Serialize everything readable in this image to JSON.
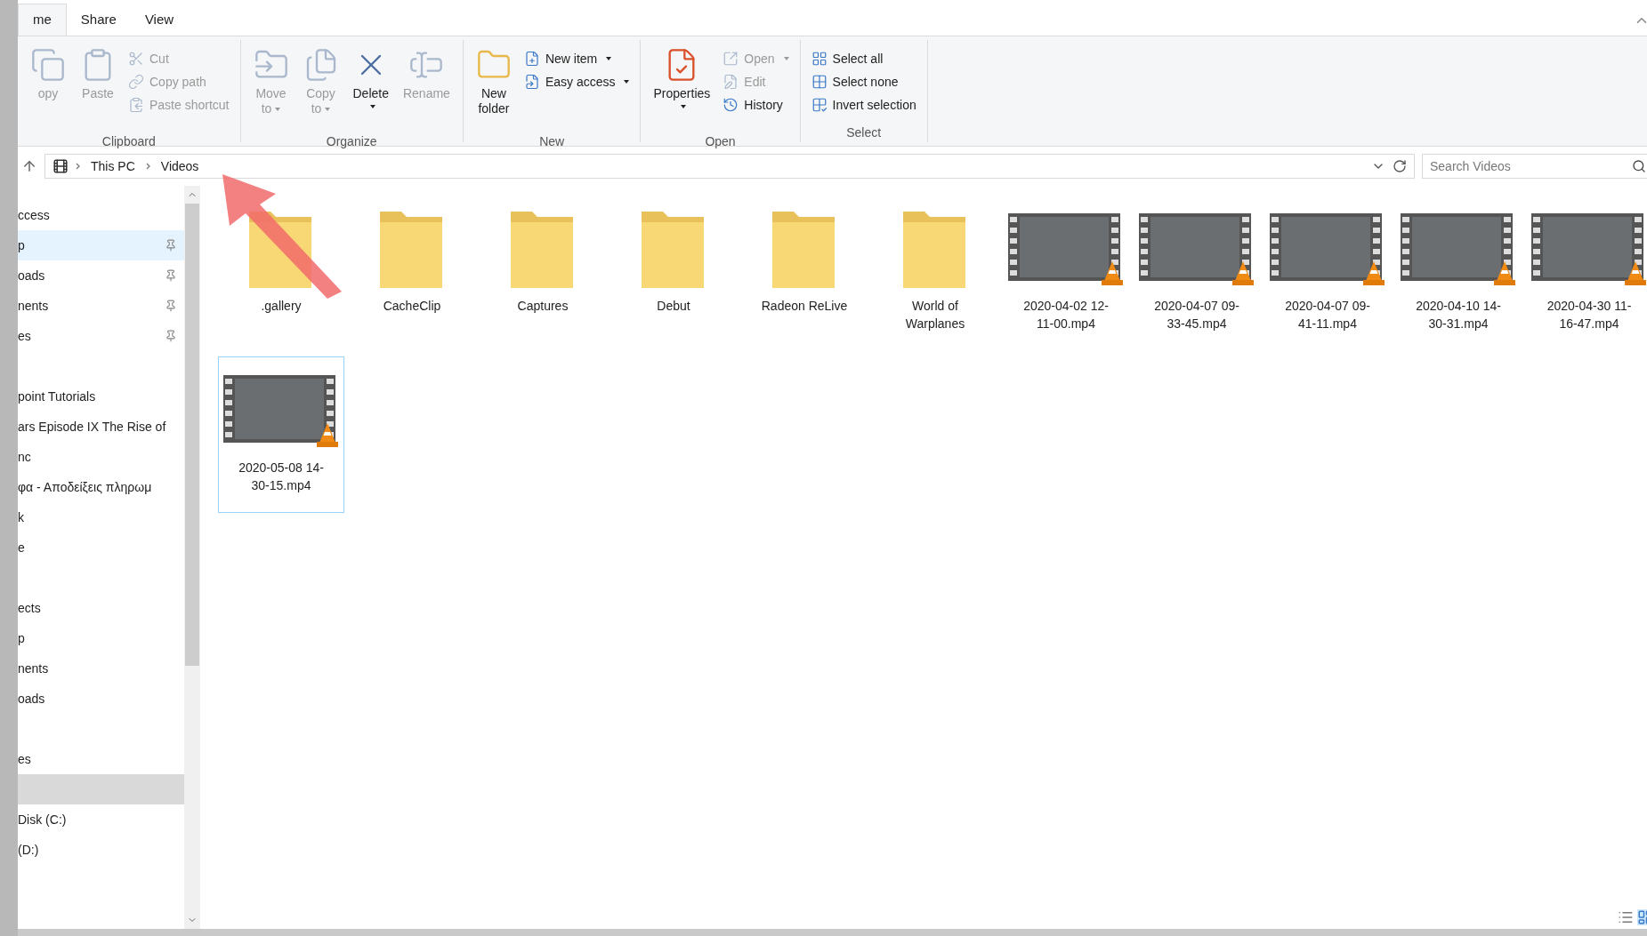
{
  "tabs": [
    {
      "label": "me",
      "selected": true
    },
    {
      "label": "Share",
      "selected": false
    },
    {
      "label": "View",
      "selected": false
    }
  ],
  "ribbon": {
    "groups": [
      {
        "label": "Clipboard",
        "commands": [
          {
            "kind": "large",
            "lines": [
              "opy"
            ],
            "disabled": true,
            "dropdown": false
          },
          {
            "kind": "large",
            "lines": [
              "Paste"
            ],
            "disabled": true,
            "dropdown": false
          },
          {
            "kind": "small",
            "lines": [
              "Cut"
            ],
            "disabled": true,
            "dropdown": false
          },
          {
            "kind": "small",
            "lines": [
              "Copy path"
            ],
            "disabled": true,
            "dropdown": false
          },
          {
            "kind": "small",
            "lines": [
              "Paste shortcut"
            ],
            "disabled": true,
            "dropdown": false
          }
        ]
      },
      {
        "label": "Organize",
        "commands": [
          {
            "kind": "large",
            "lines": [
              "Move",
              "to"
            ],
            "disabled": true,
            "dropdown": true
          },
          {
            "kind": "large",
            "lines": [
              "Copy",
              "to"
            ],
            "disabled": true,
            "dropdown": true
          },
          {
            "kind": "large",
            "lines": [
              "Delete"
            ],
            "disabled": false,
            "dropdown": true
          },
          {
            "kind": "large",
            "lines": [
              "Rename"
            ],
            "disabled": true,
            "dropdown": false
          }
        ]
      },
      {
        "label": "New",
        "commands": [
          {
            "kind": "large",
            "lines": [
              "New",
              "folder"
            ],
            "disabled": false,
            "dropdown": false
          },
          {
            "kind": "small",
            "lines": [
              "New item"
            ],
            "disabled": false,
            "dropdown": true
          },
          {
            "kind": "small",
            "lines": [
              "Easy access"
            ],
            "disabled": false,
            "dropdown": true
          }
        ]
      },
      {
        "label": "Open",
        "commands": [
          {
            "kind": "large",
            "lines": [
              "Properties"
            ],
            "disabled": false,
            "dropdown": true
          },
          {
            "kind": "small",
            "lines": [
              "Open"
            ],
            "disabled": true,
            "dropdown": true
          },
          {
            "kind": "small",
            "lines": [
              "Edit"
            ],
            "disabled": true,
            "dropdown": false
          },
          {
            "kind": "small",
            "lines": [
              "History"
            ],
            "disabled": false,
            "dropdown": false
          }
        ]
      },
      {
        "label": "Select",
        "commands": [
          {
            "kind": "small",
            "lines": [
              "Select all"
            ],
            "disabled": false,
            "dropdown": false
          },
          {
            "kind": "small",
            "lines": [
              "Select none"
            ],
            "disabled": false,
            "dropdown": false
          },
          {
            "kind": "small",
            "lines": [
              "Invert selection"
            ],
            "disabled": false,
            "dropdown": false
          }
        ]
      }
    ]
  },
  "address": {
    "breadcrumbs": [
      "This PC",
      "Videos"
    ],
    "search": {
      "placeholder": "Search Videos"
    }
  },
  "sidebar": {
    "sections": [
      {
        "items": [
          {
            "label": "ccess",
            "pinned": false,
            "hovered": false,
            "selected": false
          },
          {
            "label": "p",
            "pinned": true,
            "hovered": true,
            "selected": false
          },
          {
            "label": "oads",
            "pinned": true,
            "hovered": false,
            "selected": false
          },
          {
            "label": "nents",
            "pinned": true,
            "hovered": false,
            "selected": false
          },
          {
            "label": "es",
            "pinned": true,
            "hovered": false,
            "selected": false
          }
        ]
      },
      {
        "items": [
          {
            "label": "point Tutorials",
            "pinned": false,
            "hovered": false,
            "selected": false
          },
          {
            "label": "ars Episode IX The Rise of",
            "pinned": false,
            "hovered": false,
            "selected": false
          },
          {
            "label": "nc",
            "pinned": false,
            "hovered": false,
            "selected": false
          },
          {
            "label": "φα - Αποδείξεις πληρωμ",
            "pinned": false,
            "hovered": false,
            "selected": false
          },
          {
            "label": "k",
            "pinned": false,
            "hovered": false,
            "selected": false
          },
          {
            "label": "e",
            "pinned": false,
            "hovered": false,
            "selected": false
          }
        ]
      },
      {
        "items": [
          {
            "label": "ects",
            "pinned": false,
            "hovered": false,
            "selected": false
          },
          {
            "label": "p",
            "pinned": false,
            "hovered": false,
            "selected": false
          },
          {
            "label": "nents",
            "pinned": false,
            "hovered": false,
            "selected": false
          },
          {
            "label": "oads",
            "pinned": false,
            "hovered": false,
            "selected": false
          }
        ]
      },
      {
        "items": [
          {
            "label": "es",
            "pinned": false,
            "hovered": false,
            "selected": false
          },
          {
            "pinned": false,
            "hovered": false,
            "selected": true
          },
          {
            "label": "Disk (C:)",
            "pinned": false,
            "hovered": false,
            "selected": false
          },
          {
            "label": "(D:)",
            "pinned": false,
            "hovered": false,
            "selected": false
          }
        ]
      }
    ]
  },
  "files": [
    {
      "kind": "folder",
      "name": ".gallery",
      "selected": false
    },
    {
      "kind": "folder",
      "name": "CacheClip",
      "selected": false
    },
    {
      "kind": "folder",
      "name": "Captures",
      "selected": false
    },
    {
      "kind": "folder",
      "name": "Debut",
      "selected": false
    },
    {
      "kind": "folder",
      "name": "Radeon ReLive",
      "selected": false
    },
    {
      "kind": "folder",
      "name": "World of Warplanes",
      "selected": false
    },
    {
      "kind": "video",
      "name": "2020-04-02 12-11-00.mp4",
      "selected": false
    },
    {
      "kind": "video",
      "name": "2020-04-07 09-33-45.mp4",
      "selected": false
    },
    {
      "kind": "video",
      "name": "2020-04-07 09-41-11.mp4",
      "selected": false
    },
    {
      "kind": "video",
      "name": "2020-04-10 14-30-31.mp4",
      "selected": false
    },
    {
      "kind": "video",
      "name": "2020-04-30 11-16-47.mp4",
      "selected": false
    },
    {
      "kind": "video",
      "name": "2020-05-08 14-30-15.mp4",
      "selected": true
    }
  ]
}
